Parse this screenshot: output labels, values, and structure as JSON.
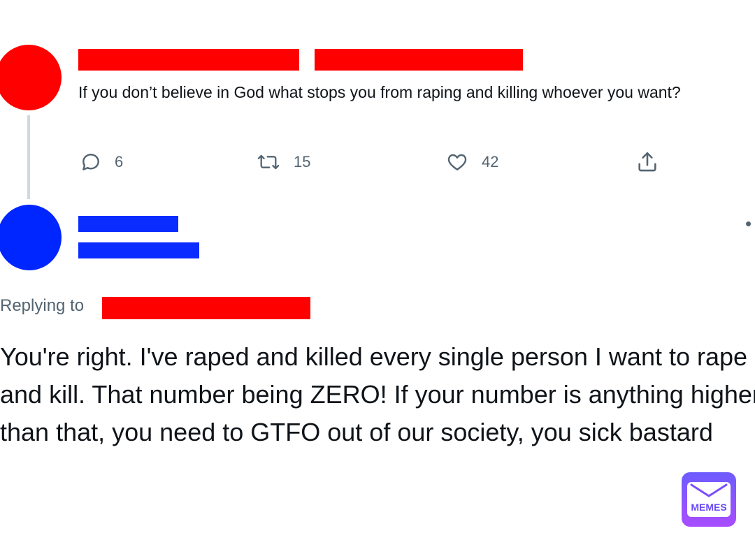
{
  "colors": {
    "redaction_red": "#ff0000",
    "redaction_blue": "#0a2cff",
    "avatar_red": "#ff0000",
    "avatar_blue": "#0026ff",
    "muted_text": "#536471",
    "brand_purple": "#7b4dff"
  },
  "original_tweet": {
    "text": "If you don’t believe in God what stops you from raping and killing whoever you want?",
    "actions": {
      "reply_count": "6",
      "retweet_count": "15",
      "like_count": "42"
    },
    "icons": [
      "reply-icon",
      "retweet-icon",
      "like-icon",
      "share-icon"
    ]
  },
  "reply_tweet": {
    "more_menu": "•",
    "replying_to_label": "Replying to",
    "text": "You're right. I've raped and killed every single person I want to rape and kill. That number being ZERO! If your number is anything higher than that, you need to GTFO out of our society, you sick bastard"
  },
  "watermark": {
    "label": "MEMES"
  }
}
